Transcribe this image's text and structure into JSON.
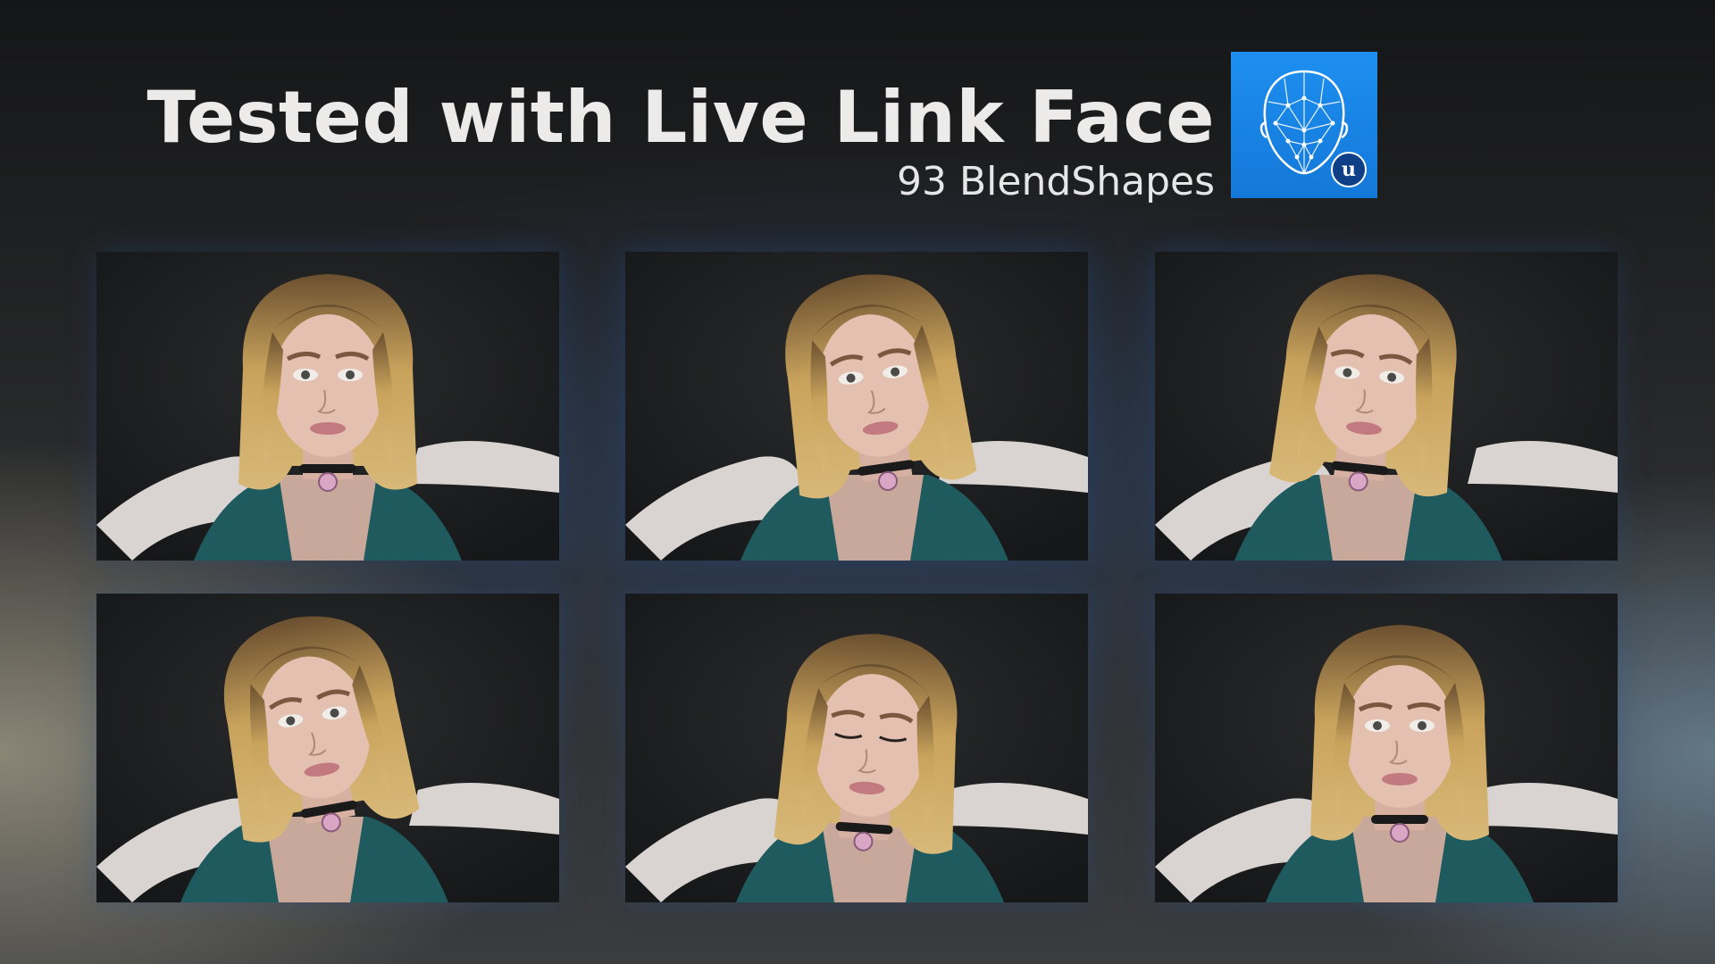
{
  "header": {
    "title": "Tested with Live Link Face",
    "subtitle": "93 BlendShapes"
  },
  "app_icon": {
    "name": "live-link-face-app-icon",
    "badge_letter": "u",
    "background_color": "#1a86e8"
  },
  "screenshots": [
    {
      "expression": "slight smile"
    },
    {
      "expression": "talking, head tilted"
    },
    {
      "expression": "lips pursed"
    },
    {
      "expression": "smirk, head tilted"
    },
    {
      "expression": "eyes closed"
    },
    {
      "expression": "neutral smile"
    }
  ],
  "colors": {
    "title_text": "#ecebea",
    "jacket_teal": "#1f5a5e",
    "hair_blonde": "#c9a35c"
  }
}
